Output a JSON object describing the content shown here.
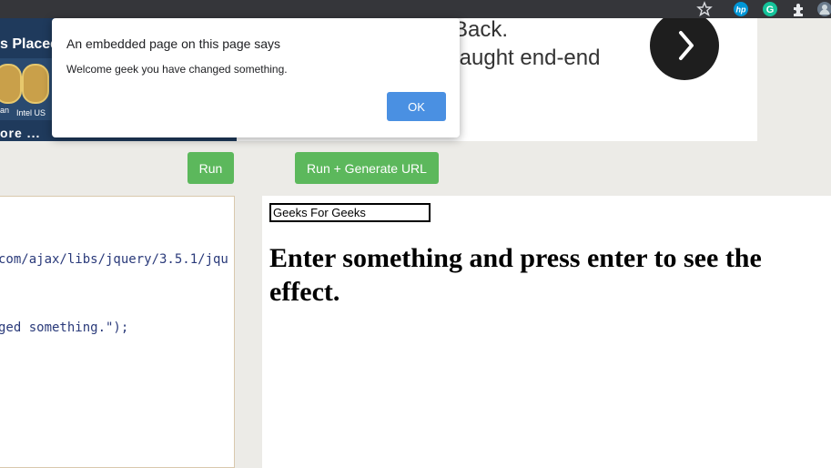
{
  "browser": {
    "icons": [
      "star-icon",
      "hp-extension-icon",
      "grammarly-extension-icon",
      "puzzle-extensions-icon",
      "profile-icon"
    ]
  },
  "banner_left": {
    "title": "s Placed",
    "caption_1": "an",
    "caption_2": "Intel US",
    "more": "ore ..."
  },
  "banner_right": {
    "line1": "Back.",
    "line2": "taught end-end"
  },
  "toolbar": {
    "run_label": "Run",
    "generate_label": "Run + Generate URL"
  },
  "editor": {
    "lines": [
      "com/ajax/libs/jquery/3.5.1/jqu",
      "ged something.\");"
    ]
  },
  "preview": {
    "input_value": "Geeks For Geeks",
    "heading": "Enter something and press enter to see the effect."
  },
  "alert": {
    "title": "An embedded page on this page says",
    "message": "Welcome geek you have changed something.",
    "ok_label": "OK"
  },
  "colors": {
    "run_button": "#5cb85c",
    "ok_button": "#4a90e2",
    "browser_bar": "#35363a",
    "banner_dark": "#1f3a5c"
  }
}
